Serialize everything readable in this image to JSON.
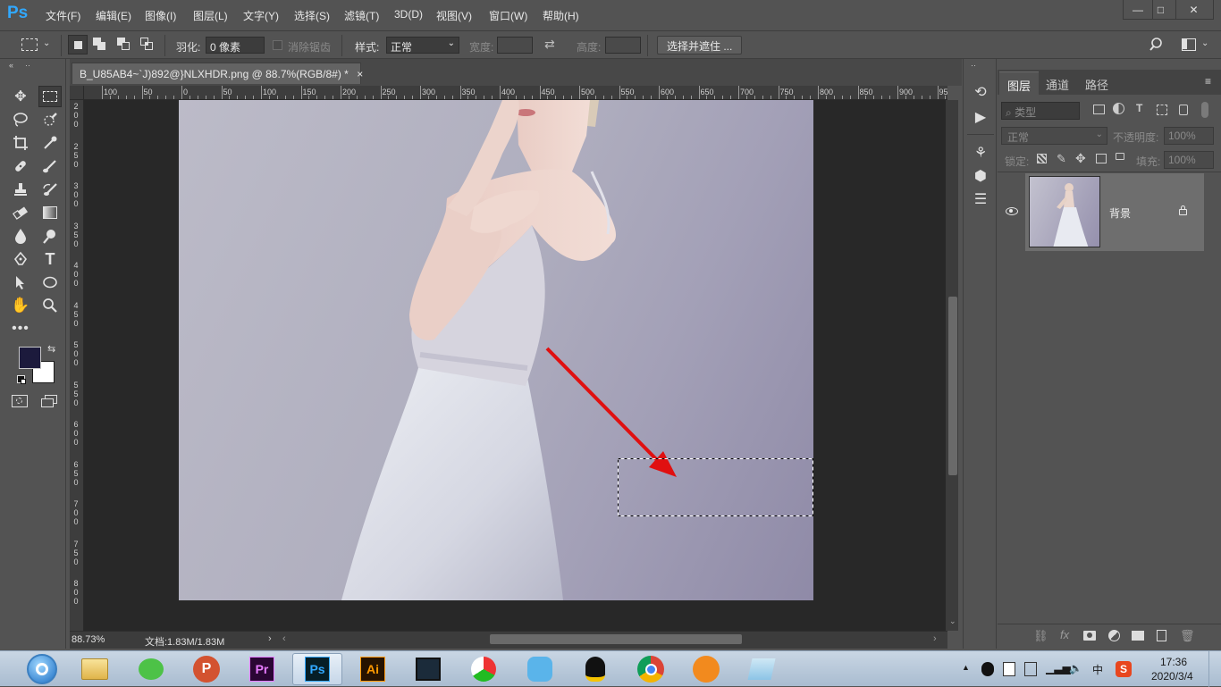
{
  "app": {
    "logo": "Ps",
    "accent": "#31a8ff"
  },
  "menu": [
    "文件(F)",
    "编辑(E)",
    "图像(I)",
    "图层(L)",
    "文字(Y)",
    "选择(S)",
    "滤镜(T)",
    "3D(D)",
    "视图(V)",
    "窗口(W)",
    "帮助(H)"
  ],
  "window_controls": {
    "minimize": "—",
    "maximize": "□",
    "close": "✕"
  },
  "options": {
    "feather_label": "羽化:",
    "feather_value": "0 像素",
    "antialias_label": "消除锯齿",
    "style_label": "样式:",
    "style_value": "正常",
    "width_label": "宽度:",
    "height_label": "高度:",
    "select_mask_button": "选择并遮住 ..."
  },
  "document": {
    "tab_title": "B_U85AB4~`J)892@}NLXHDR.png @ 88.7%(RGB/8#) *",
    "tab_close": "×",
    "zoom": "88.73%",
    "doc_info": "文档:1.83M/1.83M"
  },
  "ruler": {
    "top_labels": [
      "100",
      "50",
      "0",
      "50",
      "100",
      "150",
      "200",
      "250",
      "300",
      "350",
      "400",
      "450",
      "500",
      "550",
      "600",
      "650",
      "700",
      "750",
      "800",
      "850",
      "900",
      "95"
    ],
    "left_labels": [
      "2\n0\n0",
      "2\n5\n0",
      "3\n0\n0",
      "3\n5\n0",
      "4\n0\n0",
      "4\n5\n0",
      "5\n0\n0",
      "5\n5\n0",
      "6\n0\n0",
      "6\n5\n0",
      "7\n0\n0",
      "7\n5\n0",
      "8\n0\n0"
    ]
  },
  "layers_panel": {
    "tabs": [
      "图层",
      "通道",
      "路径"
    ],
    "filter_label": "类型",
    "blend_mode": "正常",
    "opacity_label": "不透明度:",
    "opacity_value": "100%",
    "lock_label": "锁定:",
    "fill_label": "填充:",
    "fill_value": "100%",
    "layer_name": "背景"
  },
  "colors": {
    "foreground": "#1c1a3c",
    "background": "#ffffff",
    "arrow": "#e01010"
  },
  "taskbar": {
    "time": "17:36",
    "date": "2020/3/4",
    "ime": "中"
  }
}
